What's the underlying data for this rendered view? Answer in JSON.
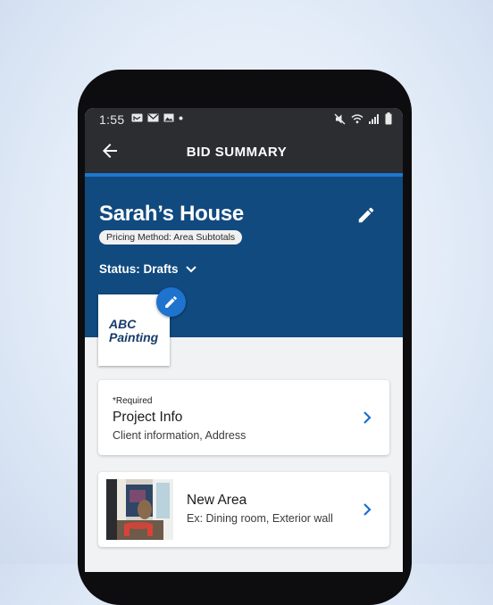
{
  "status_bar": {
    "time": "1:55"
  },
  "app_bar": {
    "title": "BID SUMMARY"
  },
  "project": {
    "name": "Sarah’s House",
    "pricing_method": "Pricing Method: Area Subtotals",
    "status": "Status: Drafts"
  },
  "logo": {
    "line1": "ABC",
    "line2": "Painting"
  },
  "cards": [
    {
      "required": "*Required",
      "title": "Project Info",
      "subtitle": "Client information, Address"
    },
    {
      "title": "New Area",
      "subtitle": "Ex: Dining room, Exterior wall"
    }
  ],
  "colors": {
    "hero": "#114a7f",
    "accent": "#1d77d2",
    "chevron": "#1d6fcf"
  }
}
